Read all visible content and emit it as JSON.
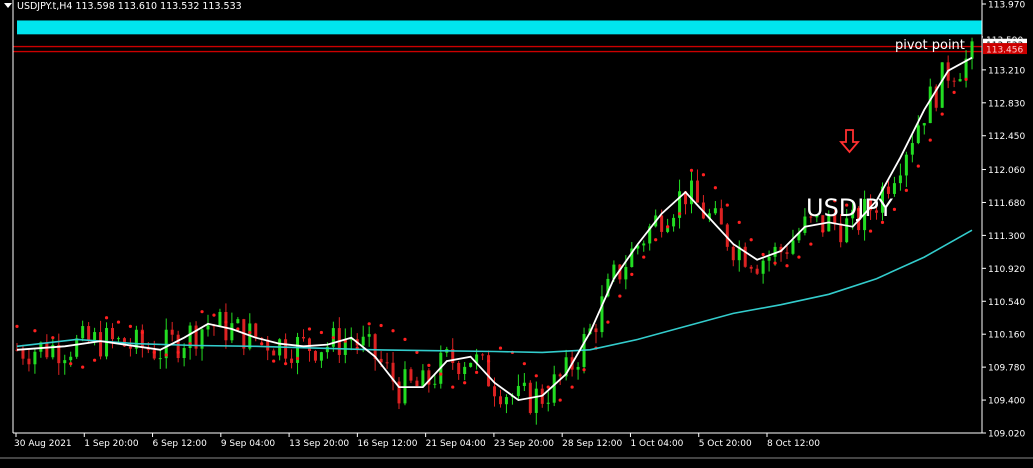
{
  "header": {
    "menu_icon": "triangle-down-icon",
    "symbol_info": "USDJPY.t,H4  113.598 113.610 113.532 113.533"
  },
  "annotations": {
    "pivot_label": "pivot point",
    "symbol_big": "USDJPY",
    "arrow_icon": "down-arrow-icon",
    "arrow_color": "#ff3030"
  },
  "colors": {
    "background": "#000000",
    "bull_candle": "#22dd22",
    "bear_candle": "#dd2222",
    "fast_ma": "#ffffff",
    "slow_ma": "#33cccc",
    "parabolic_sar": "#ff2020",
    "resistance_zone": "#00e5ee",
    "pivot_line": "#cc0000",
    "axis": "#ffffff"
  },
  "chart_data": {
    "type": "candlestick",
    "ylim": [
      109.02,
      113.97
    ],
    "y_ticks": [
      "113.970",
      "113.590",
      "113.210",
      "112.830",
      "112.450",
      "112.060",
      "111.680",
      "111.300",
      "110.920",
      "110.540",
      "110.160",
      "109.780",
      "109.400",
      "109.020"
    ],
    "x_ticks": [
      "30 Aug 2021",
      "1 Sep 20:00",
      "6 Sep 12:00",
      "9 Sep 04:00",
      "13 Sep 20:00",
      "16 Sep 12:00",
      "21 Sep 04:00",
      "23 Sep 20:00",
      "28 Sep 12:00",
      "1 Oct 04:00",
      "5 Oct 20:00",
      "8 Oct 12:00"
    ],
    "price_labels": [
      {
        "text": "113.590",
        "value": 113.56,
        "color": "#ffffff",
        "bg": "#000000"
      },
      {
        "text": "113.533",
        "value": 113.5,
        "color": "#000000",
        "bg": "#ffffff"
      },
      {
        "text": "113.456",
        "value": 113.45,
        "color": "#ffcccc",
        "bg": "#cc0000"
      }
    ],
    "resistance_zone": [
      113.62,
      113.78
    ],
    "pivot_level": 113.456,
    "fast_ma": [
      [
        0,
        109.98
      ],
      [
        8,
        110.02
      ],
      [
        14,
        110.08
      ],
      [
        20,
        110.02
      ],
      [
        24,
        109.98
      ],
      [
        28,
        110.12
      ],
      [
        32,
        110.28
      ],
      [
        36,
        110.22
      ],
      [
        40,
        110.12
      ],
      [
        44,
        110.05
      ],
      [
        48,
        110.02
      ],
      [
        52,
        110.04
      ],
      [
        56,
        110.12
      ],
      [
        60,
        109.9
      ],
      [
        64,
        109.55
      ],
      [
        68,
        109.55
      ],
      [
        72,
        109.85
      ],
      [
        76,
        109.9
      ],
      [
        80,
        109.6
      ],
      [
        84,
        109.4
      ],
      [
        88,
        109.45
      ],
      [
        92,
        109.7
      ],
      [
        96,
        110.18
      ],
      [
        100,
        110.8
      ],
      [
        104,
        111.2
      ],
      [
        108,
        111.55
      ],
      [
        112,
        111.8
      ],
      [
        116,
        111.5
      ],
      [
        120,
        111.2
      ],
      [
        124,
        111.02
      ],
      [
        128,
        111.12
      ],
      [
        132,
        111.4
      ],
      [
        136,
        111.45
      ],
      [
        140,
        111.4
      ],
      [
        144,
        111.7
      ],
      [
        148,
        112.2
      ],
      [
        152,
        112.75
      ],
      [
        156,
        113.2
      ],
      [
        160,
        113.35
      ]
    ],
    "slow_ma": [
      [
        0,
        110.02
      ],
      [
        10,
        110.1
      ],
      [
        20,
        110.05
      ],
      [
        30,
        110.03
      ],
      [
        40,
        110.02
      ],
      [
        50,
        110.0
      ],
      [
        60,
        109.98
      ],
      [
        70,
        109.97
      ],
      [
        80,
        109.96
      ],
      [
        88,
        109.95
      ],
      [
        96,
        109.98
      ],
      [
        104,
        110.1
      ],
      [
        112,
        110.25
      ],
      [
        120,
        110.4
      ],
      [
        128,
        110.5
      ],
      [
        136,
        110.62
      ],
      [
        144,
        110.8
      ],
      [
        152,
        111.05
      ],
      [
        160,
        111.36
      ]
    ],
    "parabolic_sar": [
      [
        0,
        110.25
      ],
      [
        3,
        110.2
      ],
      [
        6,
        110.12
      ],
      [
        9,
        109.82
      ],
      [
        11,
        109.78
      ],
      [
        13,
        109.86
      ],
      [
        15,
        110.35
      ],
      [
        17,
        110.3
      ],
      [
        19,
        110.25
      ],
      [
        21,
        110.18
      ],
      [
        23,
        109.95
      ],
      [
        25,
        109.92
      ],
      [
        27,
        109.95
      ],
      [
        29,
        110.05
      ],
      [
        31,
        110.42
      ],
      [
        33,
        110.38
      ],
      [
        35,
        110.3
      ],
      [
        37,
        110.22
      ],
      [
        39,
        110.18
      ],
      [
        41,
        110.05
      ],
      [
        43,
        109.85
      ],
      [
        45,
        109.82
      ],
      [
        47,
        109.88
      ],
      [
        49,
        110.22
      ],
      [
        51,
        110.18
      ],
      [
        53,
        110.12
      ],
      [
        55,
        110.08
      ],
      [
        57,
        110.0
      ],
      [
        59,
        110.28
      ],
      [
        61,
        110.26
      ],
      [
        63,
        110.2
      ],
      [
        65,
        110.1
      ],
      [
        67,
        109.95
      ],
      [
        69,
        109.8
      ],
      [
        71,
        109.7
      ],
      [
        73,
        109.55
      ],
      [
        75,
        109.6
      ],
      [
        77,
        109.72
      ],
      [
        79,
        109.85
      ],
      [
        81,
        110.0
      ],
      [
        83,
        109.95
      ],
      [
        85,
        109.82
      ],
      [
        87,
        109.68
      ],
      [
        89,
        109.55
      ],
      [
        91,
        109.4
      ],
      [
        93,
        109.55
      ],
      [
        95,
        109.75
      ],
      [
        97,
        110.0
      ],
      [
        99,
        110.3
      ],
      [
        101,
        110.6
      ],
      [
        103,
        110.85
      ],
      [
        105,
        111.05
      ],
      [
        107,
        111.25
      ],
      [
        109,
        111.4
      ],
      [
        111,
        111.55
      ],
      [
        113,
        112.05
      ],
      [
        115,
        112.0
      ],
      [
        117,
        111.85
      ],
      [
        119,
        111.65
      ],
      [
        121,
        111.45
      ],
      [
        123,
        111.25
      ],
      [
        125,
        111.08
      ],
      [
        127,
        110.98
      ],
      [
        129,
        110.95
      ],
      [
        131,
        111.05
      ],
      [
        133,
        111.2
      ],
      [
        135,
        111.35
      ],
      [
        137,
        111.7
      ],
      [
        139,
        111.65
      ],
      [
        141,
        111.6
      ],
      [
        143,
        111.35
      ],
      [
        145,
        111.45
      ],
      [
        147,
        111.6
      ],
      [
        149,
        111.82
      ],
      [
        151,
        112.1
      ],
      [
        153,
        112.4
      ],
      [
        155,
        112.7
      ],
      [
        157,
        112.95
      ],
      [
        159,
        113.1
      ]
    ]
  }
}
